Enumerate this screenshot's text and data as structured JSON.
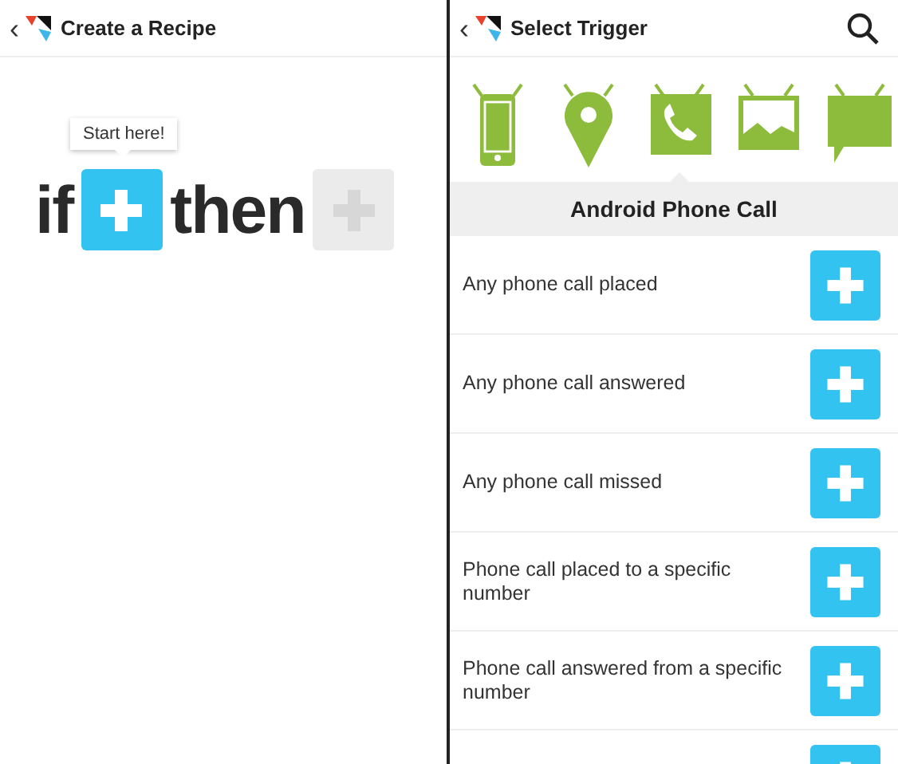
{
  "left": {
    "header": {
      "back": "‹",
      "title": "Create a Recipe"
    },
    "tooltip": "Start here!",
    "if_word": "if",
    "then_word": "then",
    "if_slot": {
      "enabled": true
    },
    "then_slot": {
      "enabled": false
    }
  },
  "right": {
    "header": {
      "back": "‹",
      "title": "Select Trigger"
    },
    "channels": [
      {
        "kind": "phone",
        "selected": false
      },
      {
        "kind": "location",
        "selected": false
      },
      {
        "kind": "call",
        "selected": true
      },
      {
        "kind": "photo",
        "selected": false
      },
      {
        "kind": "sms",
        "selected": false
      }
    ],
    "section_title": "Android Phone Call",
    "triggers": [
      {
        "label": "Any phone call placed"
      },
      {
        "label": "Any phone call answered"
      },
      {
        "label": "Any phone call missed"
      },
      {
        "label": "Phone call placed to a specific number"
      },
      {
        "label": "Phone call answered from a specific number"
      },
      {
        "kind": "cut"
      }
    ]
  }
}
